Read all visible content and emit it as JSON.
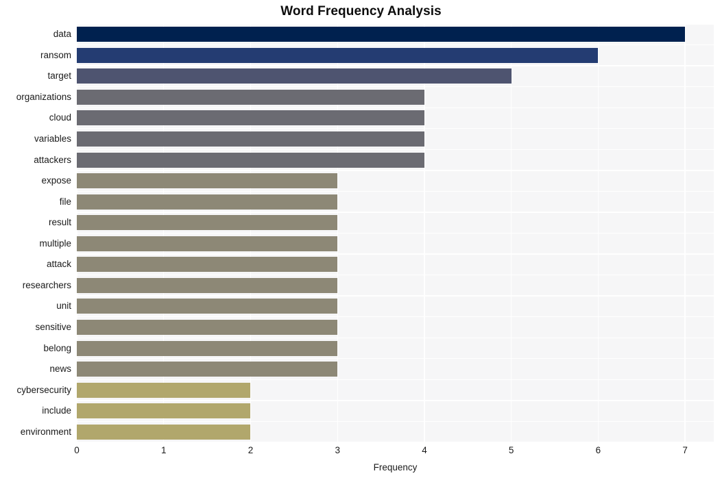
{
  "chart_data": {
    "type": "bar",
    "orientation": "horizontal",
    "title": "Word Frequency Analysis",
    "xlabel": "Frequency",
    "ylabel": "",
    "xlim": [
      0,
      7.33
    ],
    "xticks": [
      0,
      1,
      2,
      3,
      4,
      5,
      6,
      7
    ],
    "xticklabels": [
      "0",
      "1",
      "2",
      "3",
      "4",
      "5",
      "6",
      "7"
    ],
    "grid": true,
    "grid_color": "#ffffff",
    "plot_background": "#f6f6f7",
    "figure_background": "#ffffff",
    "legend": null,
    "categories": [
      "data",
      "ransom",
      "target",
      "organizations",
      "cloud",
      "variables",
      "attackers",
      "expose",
      "file",
      "result",
      "multiple",
      "attack",
      "researchers",
      "unit",
      "sensitive",
      "belong",
      "news",
      "cybersecurity",
      "include",
      "environment"
    ],
    "values": [
      7,
      6,
      5,
      4,
      4,
      4,
      4,
      3,
      3,
      3,
      3,
      3,
      3,
      3,
      3,
      3,
      3,
      2,
      2,
      2
    ],
    "bar_colors": [
      "#00214f",
      "#243c72",
      "#4e5470",
      "#6b6b72",
      "#6b6b72",
      "#6b6b72",
      "#6b6b72",
      "#8d8876",
      "#8d8876",
      "#8d8876",
      "#8d8876",
      "#8d8876",
      "#8d8876",
      "#8d8876",
      "#8d8876",
      "#8d8876",
      "#8d8876",
      "#b1a76c",
      "#b1a76c",
      "#b1a76c"
    ]
  }
}
